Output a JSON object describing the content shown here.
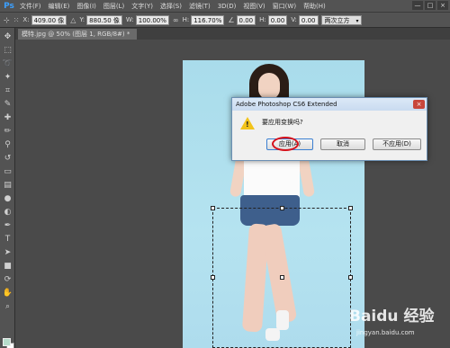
{
  "app": {
    "logo": "Ps"
  },
  "menubar": {
    "items": [
      "文件(F)",
      "编辑(E)",
      "图像(I)",
      "图层(L)",
      "文字(Y)",
      "选择(S)",
      "滤镜(T)",
      "3D(D)",
      "视图(V)",
      "窗口(W)",
      "帮助(H)"
    ],
    "window_controls": [
      "—",
      "□",
      "×"
    ]
  },
  "options_bar": {
    "x_label": "X:",
    "x_value": "409.00 像",
    "y_label": "Y:",
    "y_value": "880.50 像",
    "w_label": "W:",
    "w_value": "100.00%",
    "h_label": "H:",
    "h_value": "116.70%",
    "angle_value": "0.00",
    "hskew_label": "H:",
    "hskew_value": "0.00",
    "vskew_label": "V:",
    "vskew_value": "0.00",
    "interp_value": "两次立方"
  },
  "document": {
    "tab_label": "模特.jpg @ 50% (图层 1, RGB/8#) *"
  },
  "dialog": {
    "title": "Adobe Photoshop CS6 Extended",
    "message": "要应用变换吗?",
    "apply_label": "应用(A)",
    "cancel_label": "取消",
    "dont_apply_label": "不应用(D)",
    "close_label": "×"
  },
  "colors": {
    "foreground": "#b6dccb",
    "background": "#ffffff",
    "highlight_circle": "#d6101a"
  },
  "watermark": {
    "text": "Baidu 经验",
    "url": "jingyan.baidu.com"
  }
}
